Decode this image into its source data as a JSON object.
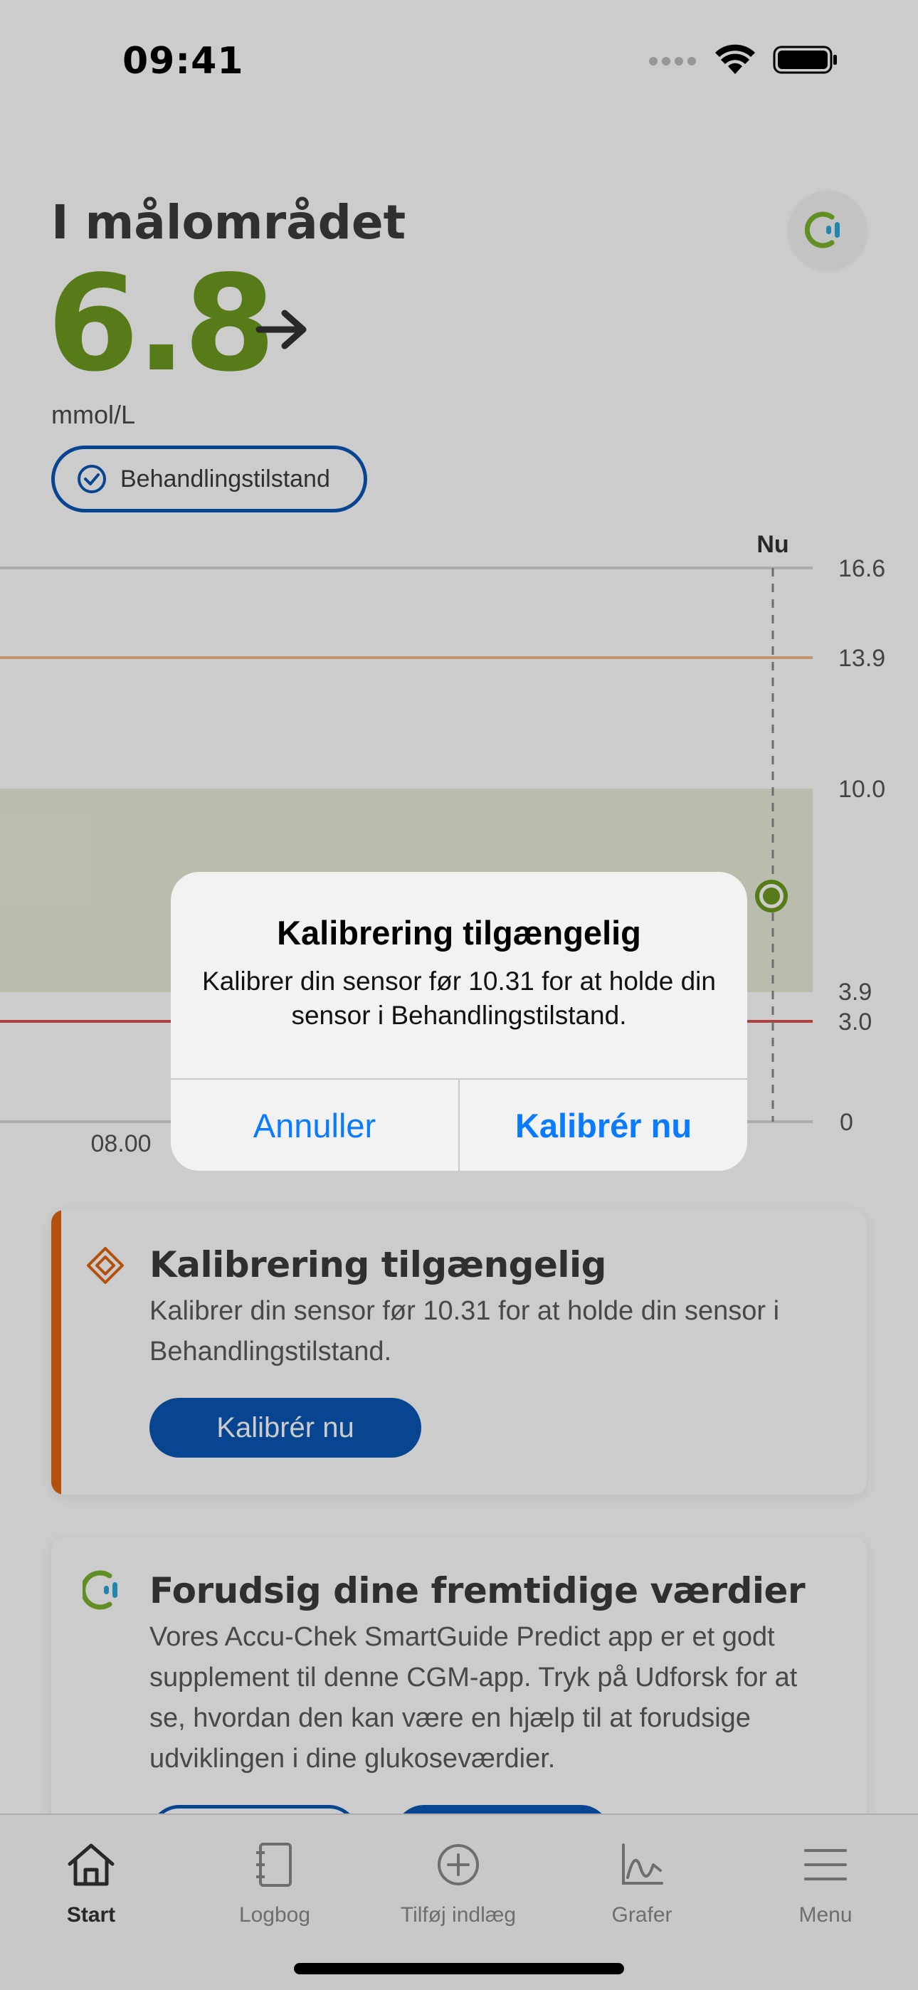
{
  "status_bar": {
    "time": "09:41"
  },
  "header": {
    "range_status": "I målområdet",
    "glucose_value": "6.8",
    "trend_icon": "arrow-right-icon",
    "unit": "mmol/L",
    "treatment_badge": "Behandlingstilstand",
    "connect_icon": "accu-chek-logo-icon"
  },
  "chart": {
    "now_label": "Nu",
    "x_tick": "08.00",
    "y_ticks": [
      "16.6",
      "13.9",
      "10.0",
      "3.9",
      "3.0",
      "0"
    ]
  },
  "chart_data": {
    "type": "line",
    "x_tick_labels": [
      "08.00"
    ],
    "now_marker": "Nu",
    "y_tick_labels": [
      "16.6",
      "13.9",
      "10.0",
      "3.9",
      "3.0",
      "0"
    ],
    "ylim": [
      0,
      16.6
    ],
    "target_range": [
      3.9,
      10.0
    ],
    "high_threshold": 13.9,
    "low_threshold": 3.0,
    "current_point": {
      "x": "Nu",
      "y": 6.8
    },
    "grid": true,
    "colors": {
      "target_band": "#e9edd9",
      "high_line": "#f0b98a",
      "low_line": "#d9534f",
      "point": "#6c9a1f"
    }
  },
  "calibration_card": {
    "title": "Kalibrering tilgængelig",
    "body": "Kalibrer din sensor før 10.31 for at holde din sensor i Behandlingstilstand.",
    "button": "Kalibrér nu",
    "icon": "diamond-warning-icon"
  },
  "predict_card": {
    "title": "Forudsig dine fremtidige værdier",
    "body": "Vores Accu-Chek SmartGuide Predict app er et godt supplement til denne CGM-app. Tryk på Udforsk for at se, hvordan den kan være en hjælp til at forudsige udviklingen i dine glukoseværdier.",
    "icon": "accu-chek-logo-icon"
  },
  "tabs": [
    {
      "label": "Start",
      "icon": "home-icon",
      "active": true
    },
    {
      "label": "Logbog",
      "icon": "logbook-icon",
      "active": false
    },
    {
      "label": "Tilføj indlæg",
      "icon": "add-circle-icon",
      "active": false
    },
    {
      "label": "Grafer",
      "icon": "graph-icon",
      "active": false
    },
    {
      "label": "Menu",
      "icon": "menu-icon",
      "active": false
    }
  ],
  "dialog": {
    "title": "Kalibrering tilgængelig",
    "message": "Kalibrer din sensor før 10.31 for at holde din sensor i Behandlingstilstand.",
    "cancel": "Annuller",
    "confirm": "Kalibrér nu"
  },
  "colors": {
    "accent_blue": "#0a57b5",
    "in_range_green": "#6c9a1f",
    "warning_orange": "#e2650f",
    "ios_link_blue": "#0a7aff"
  }
}
